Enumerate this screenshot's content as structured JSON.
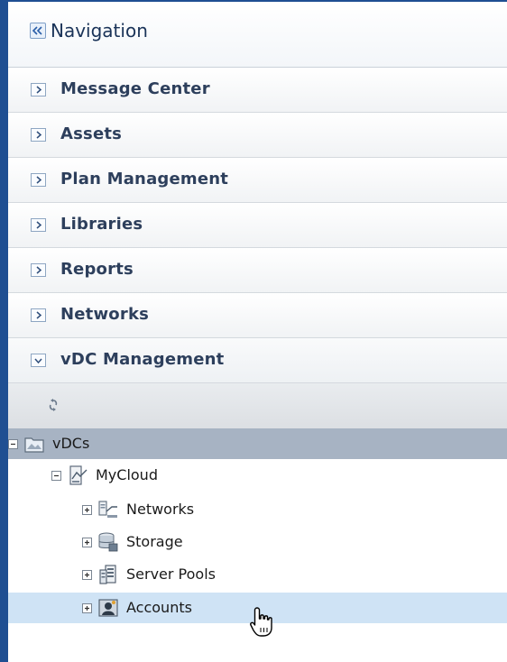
{
  "navigation": {
    "title": "Navigation"
  },
  "accordion": [
    {
      "label": "Message Center",
      "expanded": false
    },
    {
      "label": "Assets",
      "expanded": false
    },
    {
      "label": "Plan Management",
      "expanded": false
    },
    {
      "label": "Libraries",
      "expanded": false
    },
    {
      "label": "Reports",
      "expanded": false
    },
    {
      "label": "Networks",
      "expanded": false
    },
    {
      "label": "vDC Management",
      "expanded": true
    }
  ],
  "toolbar": {
    "refresh_icon": "refresh-icon"
  },
  "tree": {
    "root": {
      "label": "vDCs",
      "icon": "vdc-folder-icon"
    },
    "cloud": {
      "label": "MyCloud",
      "icon": "cloud-icon"
    },
    "children": [
      {
        "label": "Networks",
        "icon": "network-icon"
      },
      {
        "label": "Storage",
        "icon": "storage-icon"
      },
      {
        "label": "Server Pools",
        "icon": "server-pool-icon"
      },
      {
        "label": "Accounts",
        "icon": "account-icon"
      }
    ],
    "selected": "Accounts"
  },
  "colors": {
    "frame": "#1f4f92",
    "root_row": "#a7b3c3",
    "selected_row": "#cfe3f5"
  }
}
